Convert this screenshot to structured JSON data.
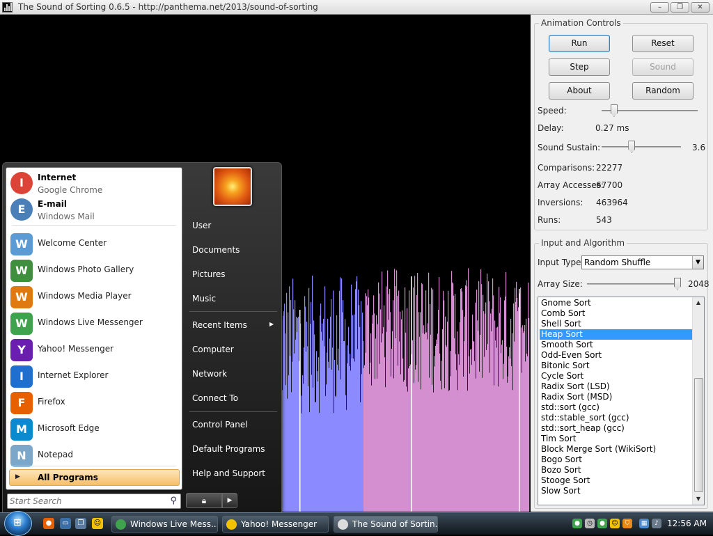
{
  "window": {
    "title": "The Sound of Sorting 0.6.5 - http://panthema.net/2013/sound-of-sorting",
    "minimize": "–",
    "maximize": "❐",
    "close": "✕"
  },
  "animation_controls": {
    "label": "Animation Controls",
    "buttons": {
      "run": "Run",
      "reset": "Reset",
      "step": "Step",
      "sound": "Sound",
      "about": "About",
      "random": "Random"
    },
    "speed_label": "Speed:",
    "speed_level": 0.13,
    "delay_label": "Delay:",
    "delay_value": "0.27 ms",
    "sustain_label": "Sound Sustain:",
    "sustain_value": "3.6",
    "sustain_level": 0.38,
    "comparisons_label": "Comparisons:",
    "comparisons_value": "22277",
    "accesses_label": "Array Accesses:",
    "accesses_value": "67700",
    "inversions_label": "Inversions:",
    "inversions_value": "463964",
    "runs_label": "Runs:",
    "runs_value": "543"
  },
  "input_algorithm": {
    "label": "Input and Algorithm",
    "input_type_label": "Input Type:",
    "input_type_value": "Random Shuffle",
    "array_size_label": "Array Size:",
    "array_size_value": "2048",
    "array_size_level": 0.97,
    "algorithms": [
      "Gnome Sort",
      "Comb Sort",
      "Shell Sort",
      "Heap Sort",
      "Smooth Sort",
      "Odd-Even Sort",
      "Bitonic Sort",
      "Cycle Sort",
      "Radix Sort (LSD)",
      "Radix Sort (MSD)",
      "std::sort (gcc)",
      "std::stable_sort (gcc)",
      "std::sort_heap (gcc)",
      "Tim Sort",
      "Block Merge Sort (WikiSort)",
      "Bogo Sort",
      "Bozo Sort",
      "Stooge Sort",
      "Slow Sort"
    ],
    "selected_index": 3
  },
  "visualization": {
    "color_sorted": "#8b8bff",
    "color_unsorted": "#d48fd1",
    "color_active": "#ffffff"
  },
  "start_menu": {
    "pinned": [
      {
        "name": "Internet",
        "sub": "Google Chrome",
        "icon": "chrome-icon",
        "color": "#db4437"
      },
      {
        "name": "E-mail",
        "sub": "Windows Mail",
        "icon": "mail-icon",
        "color": "#4a7fb8"
      }
    ],
    "recent": [
      {
        "name": "Welcome Center",
        "icon": "welcome-center-icon",
        "color": "#5a9bd5"
      },
      {
        "name": "Windows Photo Gallery",
        "icon": "photo-gallery-icon",
        "color": "#3f8f3f"
      },
      {
        "name": "Windows Media Player",
        "icon": "media-player-icon",
        "color": "#e07a10"
      },
      {
        "name": "Windows Live Messenger",
        "icon": "live-messenger-icon",
        "color": "#3fa34d"
      },
      {
        "name": "Yahoo! Messenger",
        "icon": "yahoo-messenger-icon",
        "color": "#6b1fb1"
      },
      {
        "name": "Internet Explorer",
        "icon": "internet-explorer-icon",
        "color": "#1f6fd0"
      },
      {
        "name": "Firefox",
        "icon": "firefox-icon",
        "color": "#e66000"
      },
      {
        "name": "Microsoft Edge",
        "icon": "edge-icon",
        "color": "#0c8ad0"
      },
      {
        "name": "Notepad",
        "icon": "notepad-icon",
        "color": "#7da7c9"
      }
    ],
    "all_programs": "All Programs",
    "search_placeholder": "Start Search",
    "right_items": [
      "User",
      "Documents",
      "Pictures",
      "Music",
      "Recent Items",
      "Computer",
      "Network",
      "Connect To",
      "Control Panel",
      "Default Programs",
      "Help and Support"
    ],
    "power_icon": "lock-icon"
  },
  "taskbar": {
    "tasks": [
      {
        "label": "Windows Live Mess...",
        "icon": "live-messenger-icon"
      },
      {
        "label": "Yahoo! Messenger",
        "icon": "yahoo-messenger-icon"
      },
      {
        "label": "The Sound of Sortin...",
        "icon": "sound-of-sorting-icon"
      }
    ],
    "clock": "12:56 AM"
  }
}
